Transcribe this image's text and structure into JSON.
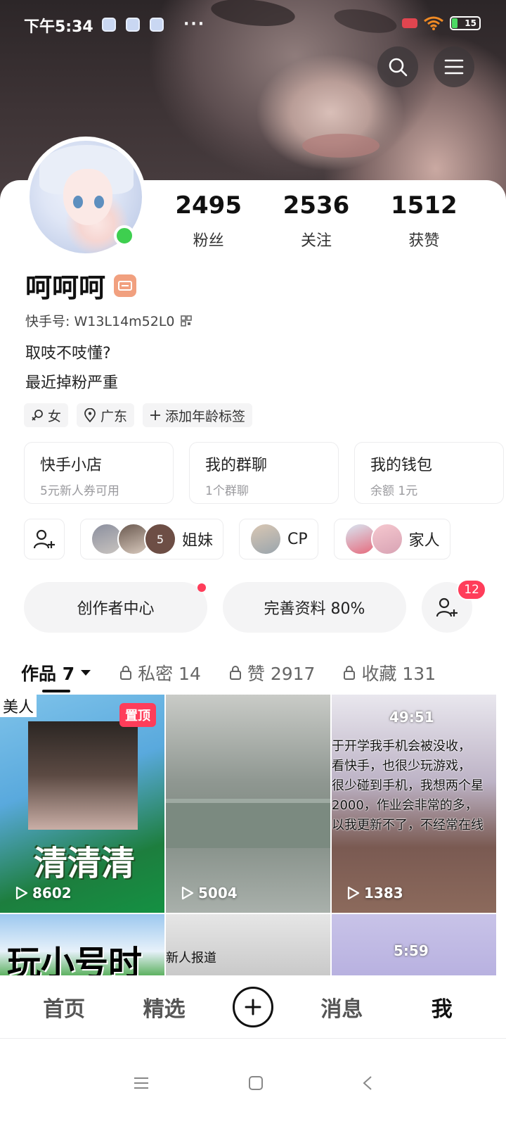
{
  "status_bar": {
    "time": "下午5:34",
    "more": "···",
    "battery": "15"
  },
  "stats": [
    {
      "value": "2495",
      "label": "粉丝"
    },
    {
      "value": "2536",
      "label": "关注"
    },
    {
      "value": "1512",
      "label": "获赞"
    }
  ],
  "profile": {
    "name": "呵呵呵",
    "kuaishou_id": "快手号: W13L14m52L0",
    "bio_line1": "取吱不吱懂?",
    "bio_line2": "最近掉粉严重"
  },
  "tags": [
    {
      "icon": "female-icon",
      "label": "女"
    },
    {
      "icon": "location-icon",
      "label": "广东"
    },
    {
      "icon": "plus-icon",
      "label": "添加年龄标签"
    }
  ],
  "shop_cards": [
    {
      "title": "快手小店",
      "sub": "5元新人券可用"
    },
    {
      "title": "我的群聊",
      "sub": "1个群聊"
    },
    {
      "title": "我的钱包",
      "sub": "余额 1元"
    }
  ],
  "groups": [
    {
      "label": "姐妹",
      "extra_count": "5"
    },
    {
      "label": "CP"
    },
    {
      "label": "家人"
    }
  ],
  "actions": {
    "creator": "创作者中心",
    "profile": "完善资料 80%",
    "friend_badge": "12"
  },
  "tabs": [
    {
      "label": "作品 7",
      "active": true
    },
    {
      "label": "私密 14"
    },
    {
      "label": "赞 2917"
    },
    {
      "label": "收藏 131"
    }
  ],
  "works": [
    {
      "plays": "8602",
      "pinned": "置顶",
      "caption": "清清清",
      "corner": "美人"
    },
    {
      "plays": "5004"
    },
    {
      "plays": "1383",
      "timer": "49:51",
      "text": "于开学我手机会被没收，\n看快手，也很少玩游戏，\n很少碰到手机，我想两个星\n2000，作业会非常的多，\n以我更新不了，不经常在线"
    },
    {
      "caption": "玩小号时"
    },
    {
      "caption": "新人报道"
    },
    {
      "timer": "5:59"
    }
  ],
  "bottom_nav": {
    "home": "首页",
    "featured": "精选",
    "messages": "消息",
    "me": "我"
  }
}
